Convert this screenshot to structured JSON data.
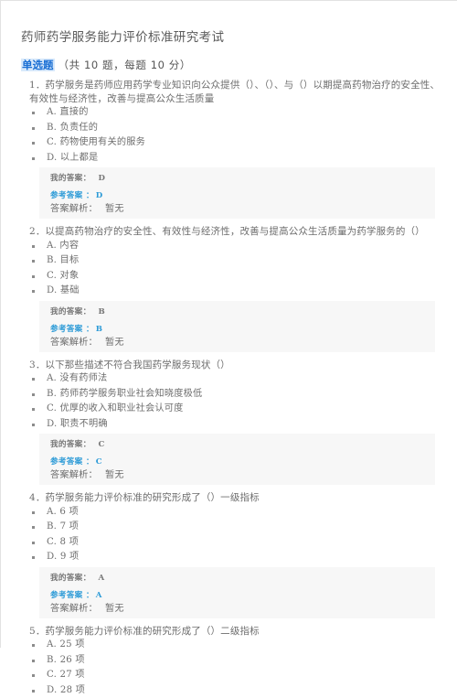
{
  "exam": {
    "title": "药师药学服务能力评价标准研究考试",
    "section": {
      "type_label": "单选题",
      "meta": "（共 10 题，每题 10 分）"
    },
    "labels": {
      "my_answer": "我的答案：",
      "reference_answer": "参考答案 ：",
      "explanation": "答案解析：",
      "explanation_value": "暂无"
    },
    "questions": [
      {
        "stem": "1．药学服务是药师应用药学专业知识向公众提供（）、（）、与（）以期提高药物治疗的安全性、有效性与经济性，改善与提高公众生活质量",
        "options": [
          "A. 直接的",
          "B. 负责任的",
          "C. 药物使用有关的服务",
          "D. 以上都是"
        ],
        "my_answer": "D",
        "reference_answer": "D",
        "has_answer_box": true
      },
      {
        "stem": "2．以提高药物治疗的安全性、有效性与经济性，改善与提高公众生活质量为药学服务的（）",
        "options": [
          "A. 内容",
          "B. 目标",
          "C. 对象",
          "D. 基础"
        ],
        "my_answer": "B",
        "reference_answer": "B",
        "has_answer_box": true
      },
      {
        "stem": "3．以下那些描述不符合我国药学服务现状（）",
        "options": [
          "A. 没有药师法",
          "B. 药师药学服务职业社会知晓度极低",
          "C. 优厚的收入和职业社会认可度",
          "D. 职责不明确"
        ],
        "my_answer": "C",
        "reference_answer": "C",
        "has_answer_box": true
      },
      {
        "stem": "4．药学服务能力评价标准的研究形成了（）一级指标",
        "options": [
          "A. 6 项",
          "B. 7 项",
          "C. 8 项",
          "D. 9 项"
        ],
        "my_answer": "A",
        "reference_answer": "A",
        "has_answer_box": true
      },
      {
        "stem": "5．药学服务能力评价标准的研究形成了（）二级指标",
        "options": [
          "A. 25 项",
          "B. 26 项",
          "C. 27 项",
          "D. 28 项"
        ],
        "my_answer": "",
        "reference_answer": "",
        "has_answer_box": false
      }
    ]
  },
  "colors": {
    "accent_blue": "#2d9bd7",
    "badge_blue": "#1a6fd4",
    "badge_bg": "#d8e9fb",
    "answer_box_bg": "#f7f7f7",
    "text_gray": "#6d6d6d"
  }
}
